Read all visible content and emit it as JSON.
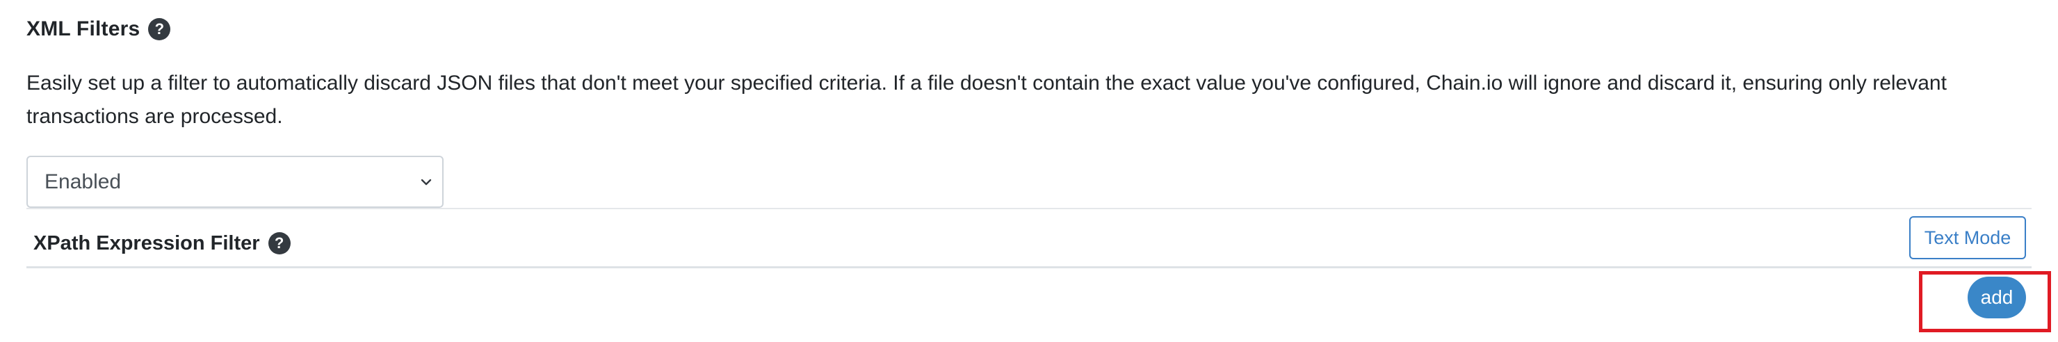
{
  "xml_filters": {
    "title": "XML Filters",
    "help_icon_glyph": "?",
    "description": "Easily set up a filter to automatically discard JSON files that don't meet your specified criteria. If a file doesn't contain the exact value you've configured, Chain.io will ignore and discard it, ensuring only relevant transactions are processed.",
    "status_select": {
      "selected_value": "Enabled",
      "icon": "chevron-down-icon"
    }
  },
  "xpath_filter": {
    "title": "XPath Expression Filter",
    "help_icon_glyph": "?",
    "text_mode_label": "Text Mode",
    "add_label": "add"
  },
  "colors": {
    "accent": "#3a87c8",
    "outline_button": "#3a7fc7",
    "help_icon_bg": "#343a40",
    "highlight": "#e01b24",
    "divider": "#dee2e6"
  }
}
